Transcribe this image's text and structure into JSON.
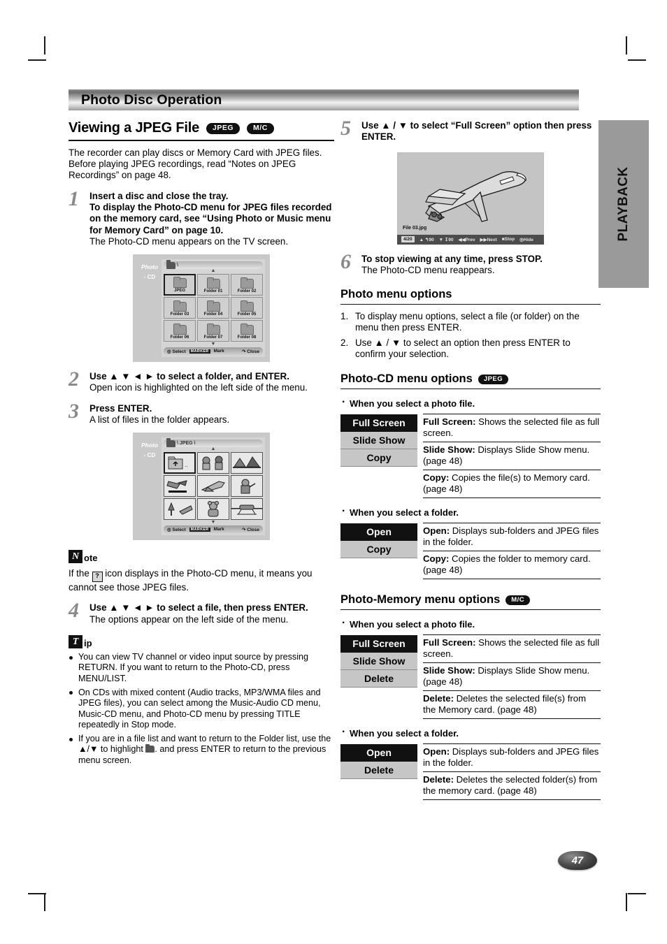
{
  "section": {
    "title": "Photo Disc Operation"
  },
  "side_tab": {
    "label": "PLAYBACK"
  },
  "page_number": "47",
  "badges": {
    "jpeg": "JPEG",
    "mc": "M/C"
  },
  "left": {
    "heading": "Viewing a JPEG File",
    "intro": "The recorder can play discs or Memory Card with JPEG files. Before playing JPEG recordings, read “Notes on JPEG Recordings” on page 48.",
    "steps": [
      {
        "num": "1",
        "bold_lines": [
          "Insert a disc and close the tray.",
          "To display the Photo-CD menu for JPEG files recorded on the memory card, see “Using Photo or Music menu for Memory Card” on page 10."
        ],
        "plain": "The Photo-CD menu appears on the TV screen."
      },
      {
        "num": "2",
        "bold_lines": [
          "Use ▲ ▼ ◄ ► to select a folder, and ENTER."
        ],
        "plain": "Open icon is highlighted on the left side of the menu."
      },
      {
        "num": "3",
        "bold_lines": [
          "Press ENTER."
        ],
        "plain": "A list of files in the folder appears."
      },
      {
        "num": "4",
        "bold_lines": [
          "Use ▲ ▼ ◄ ► to select a file, then press ENTER."
        ],
        "plain": "The options appear on the left side of the menu."
      }
    ],
    "folder_menu": {
      "label_line1": "Photo",
      "label_line2": "- CD",
      "path": "\\",
      "cells": [
        "JPEG",
        "Folder 01",
        "Folder 02",
        "Folder 03",
        "Folder 04",
        "Folder 05",
        "Folder 06",
        "Folder 07",
        "Folder 08"
      ],
      "bar": {
        "select": "Select",
        "marker": "MARKER",
        "mark": "Mark",
        "close": "Close"
      }
    },
    "file_menu": {
      "label_line1": "Photo",
      "label_line2": "- CD",
      "path": "\\ JPEG \\",
      "bar": {
        "select": "Select",
        "marker": "MARKER",
        "mark": "Mark",
        "close": "Close"
      }
    },
    "note": {
      "glyph": "N",
      "title": "ote",
      "text_before": "If the",
      "text_after": "icon displays in the Photo-CD menu, it means you cannot see those JPEG files."
    },
    "tip": {
      "glyph": "T",
      "title": "ip",
      "items": [
        "You can view TV channel or video input source by pressing RETURN. If you want to return to the Photo-CD, press MENU/LIST.",
        "On CDs with mixed content (Audio tracks, MP3/WMA files and JPEG files), you can select among the Music-Audio CD menu, Music-CD menu, and Photo-CD menu by pressing TITLE repeatedly in Stop mode.",
        "If you are in a file list and want to return to the Folder list, use the ▲/▼ to highlight"
      ],
      "item3_tail": ". and press ENTER to return to the previous menu screen."
    }
  },
  "right": {
    "step5": {
      "num": "5",
      "bold_lines": [
        "Use ▲ / ▼ to select “Full Screen” option then press ENTER."
      ]
    },
    "fullscreen": {
      "file_name": "File 03.jpg",
      "counter": "4/20",
      "rotate_up": "90",
      "rotate_down": "90",
      "prev": "Prev",
      "next": "Next",
      "stop": "Stop",
      "hide": "Hide"
    },
    "step6": {
      "num": "6",
      "bold_lines": [
        "To stop viewing at any time, press STOP."
      ],
      "plain": "The Photo-CD menu reappears."
    },
    "photo_menu_options": {
      "heading": "Photo menu options",
      "items": [
        "To display menu options, select a file (or folder) on the menu then press ENTER.",
        "Use ▲ / ▼ to select an option then press ENTER to confirm your selection."
      ]
    },
    "photo_cd": {
      "heading": "Photo-CD menu options",
      "file_caption": "When you select a photo file.",
      "file_options": [
        "Full Screen",
        "Slide Show",
        "Copy"
      ],
      "file_descs": [
        {
          "term": "Full Screen:",
          "desc": " Shows the selected file as full screen."
        },
        {
          "term": "Slide Show:",
          "desc": " Displays Slide Show menu. (page 48)"
        },
        {
          "term": "Copy:",
          "desc": " Copies the file(s) to Memory card. (page 48)"
        }
      ],
      "folder_caption": "When you select a folder.",
      "folder_options": [
        "Open",
        "Copy"
      ],
      "folder_descs": [
        {
          "term": "Open:",
          "desc": " Displays sub-folders and JPEG files in the folder."
        },
        {
          "term": "Copy:",
          "desc": " Copies the folder to memory card. (page 48)"
        }
      ]
    },
    "photo_memory": {
      "heading": "Photo-Memory menu options",
      "file_caption": "When you select a photo file.",
      "file_options": [
        "Full Screen",
        "Slide Show",
        "Delete"
      ],
      "file_descs": [
        {
          "term": "Full Screen:",
          "desc": " Shows the selected file as full screen."
        },
        {
          "term": "Slide Show:",
          "desc": " Displays Slide Show menu. (page 48)"
        },
        {
          "term": "Delete:",
          "desc": " Deletes the selected file(s) from the Memory card. (page 48)"
        }
      ],
      "folder_caption": "When you select a folder.",
      "folder_options": [
        "Open",
        "Delete"
      ],
      "folder_descs": [
        {
          "term": "Open:",
          "desc": " Displays sub-folders and JPEG files in the folder."
        },
        {
          "term": "Delete:",
          "desc": " Deletes the selected folder(s) from the memory card. (page 48)"
        }
      ]
    }
  }
}
